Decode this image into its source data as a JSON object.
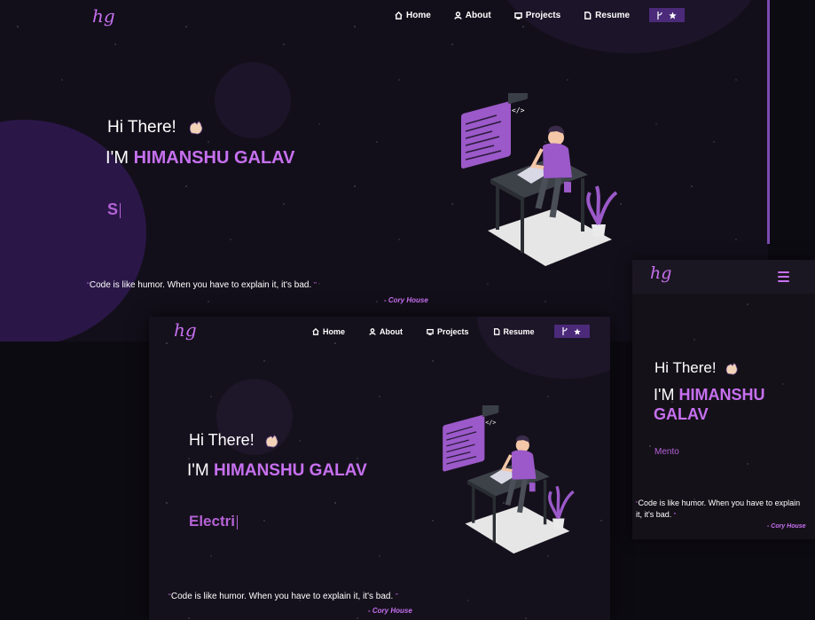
{
  "brand": {
    "logo_text": "hg",
    "accent": "#c770f0",
    "background": "#130f1a"
  },
  "nav": {
    "items": [
      {
        "label": "Home",
        "icon": "home-icon"
      },
      {
        "label": "About",
        "icon": "user-icon"
      },
      {
        "label": "Projects",
        "icon": "projects-icon"
      },
      {
        "label": "Resume",
        "icon": "document-icon"
      }
    ],
    "github_star_icons": [
      "fork-icon",
      "star-icon"
    ]
  },
  "hero": {
    "greeting": "Hi There!",
    "wave_icon": "waving-hand-icon",
    "name_prefix": "I'M",
    "name": "HIMANSHU GALAV",
    "name_line1": "HIMANSHU",
    "name_line2": "GALAV"
  },
  "typewriter": {
    "desktop_text": "S",
    "tablet_text": "Electri",
    "mobile_text": "Mento"
  },
  "quote": {
    "text": "Code is like humor. When you have to explain it, it's bad.",
    "mobile_line1": "Code is like humor. When you have to explain",
    "mobile_line2": "it, it's bad.",
    "author": "- Cory House"
  },
  "mobile_nav": {
    "menu_icon": "hamburger-menu-icon"
  }
}
